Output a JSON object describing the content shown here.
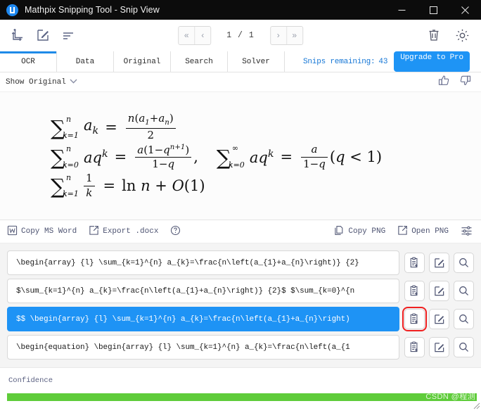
{
  "window": {
    "title": "Mathpix Snipping Tool - Snip View",
    "logo_icon": "mathpix-logo-icon",
    "controls": {
      "minimize": "minimize-icon",
      "maximize": "maximize-icon",
      "close": "close-icon"
    }
  },
  "toolbar": {
    "icons": [
      {
        "name": "new-snip-icon"
      },
      {
        "name": "edit-snip-icon"
      },
      {
        "name": "list-view-icon"
      }
    ],
    "pager": {
      "first_label": "«",
      "prev_label": "‹",
      "page_label": "1 / 1",
      "next_label": "›",
      "last_label": "»"
    },
    "right_icons": [
      {
        "name": "trash-icon"
      },
      {
        "name": "gear-icon"
      }
    ]
  },
  "tabs": {
    "items": [
      {
        "label": "OCR",
        "active": true
      },
      {
        "label": "Data",
        "active": false
      },
      {
        "label": "Original",
        "active": false
      },
      {
        "label": "Search",
        "active": false
      },
      {
        "label": "Solver",
        "active": false
      }
    ],
    "snips_remaining_label": "Snips remaining:",
    "snips_remaining_value": "43",
    "upgrade_label": "Upgrade to Pro",
    "accent_color": "#1e8ae8"
  },
  "show_row": {
    "show_original_label": "Show Original",
    "chevron_icon": "chevron-down-icon",
    "thumbs_up_icon": "thumbs-up-icon",
    "thumbs_down_icon": "thumbs-down-icon"
  },
  "preview": {
    "equations": [
      "\\sum_{k=1}^{n} a_k = \\frac{n(a_1+a_n)}{2}",
      "\\sum_{k=0}^{n} aq^k = \\frac{a(1-q^{n+1})}{1-q},\\quad \\sum_{k=0}^{\\infty} aq^k = \\frac{a}{1-q}(q<1)",
      "\\sum_{k=1}^{n} \\frac{1}{k} = \\ln n + O(1)"
    ],
    "sum_glyph": "∑",
    "infinity_glyph": "∞"
  },
  "action_bar": {
    "left": [
      {
        "label": "Copy MS Word",
        "icon": "word-doc-icon"
      },
      {
        "label": "Export .docx",
        "icon": "export-icon"
      },
      {
        "label": "",
        "icon": "help-circle-icon"
      }
    ],
    "right": [
      {
        "label": "Copy PNG",
        "icon": "copy-page-icon"
      },
      {
        "label": "Open PNG",
        "icon": "open-external-icon"
      },
      {
        "label": "",
        "icon": "settings-sliders-icon"
      }
    ]
  },
  "results": {
    "row_action_icons": [
      "clipboard-copy-icon",
      "edit-square-icon",
      "search-icon"
    ],
    "rows": [
      {
        "text": "\\begin{array} {l} \\sum_{k=1}^{n} a_{k}=\\frac{n\\left(a_{1}+a_{n}\\right)} {2}",
        "selected": false,
        "highlight_copy": false
      },
      {
        "text": "$\\sum_{k=1}^{n} a_{k}=\\frac{n\\left(a_{1}+a_{n}\\right)} {2}$ $\\sum_{k=0}^{n",
        "selected": false,
        "highlight_copy": false
      },
      {
        "text": "$$  \\begin{array} {l} \\sum_{k=1}^{n} a_{k}=\\frac{n\\left(a_{1}+a_{n}\\right)",
        "selected": true,
        "highlight_copy": true
      },
      {
        "text": "\\begin{equation}  \\begin{array} {l} \\sum_{k=1}^{n} a_{k}=\\frac{n\\left(a_{1",
        "selected": false,
        "highlight_copy": false
      }
    ],
    "selection_color": "#1e93f5",
    "highlight_color": "#f02020"
  },
  "confidence": {
    "label": "Confidence",
    "percent": 100,
    "bar_color": "#5fcc3a"
  },
  "watermark": {
    "text": "CSDN @程测"
  }
}
